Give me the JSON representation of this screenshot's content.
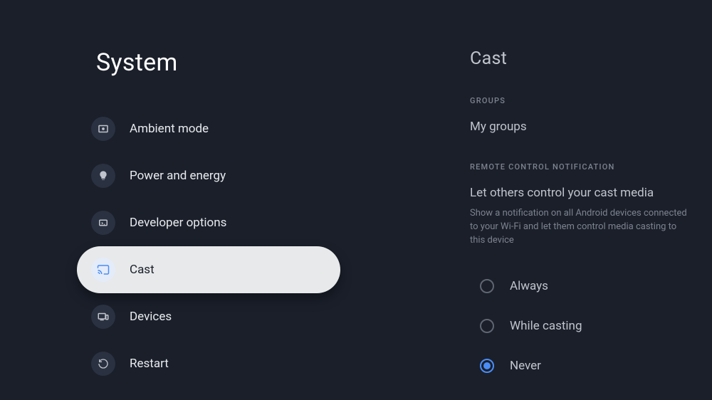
{
  "left": {
    "title": "System",
    "items": [
      {
        "label": "Ambient mode"
      },
      {
        "label": "Power and energy"
      },
      {
        "label": "Developer options"
      },
      {
        "label": "Cast"
      },
      {
        "label": "Devices"
      },
      {
        "label": "Restart"
      }
    ]
  },
  "right": {
    "title": "Cast",
    "groups_header": "GROUPS",
    "groups_item": "My groups",
    "notif_header": "REMOTE CONTROL NOTIFICATION",
    "setting_title": "Let others control your cast media",
    "setting_desc": "Show a notification on all Android devices connected to your Wi-Fi and let them control media casting to this device",
    "options": [
      {
        "label": "Always"
      },
      {
        "label": "While casting"
      },
      {
        "label": "Never"
      }
    ]
  }
}
